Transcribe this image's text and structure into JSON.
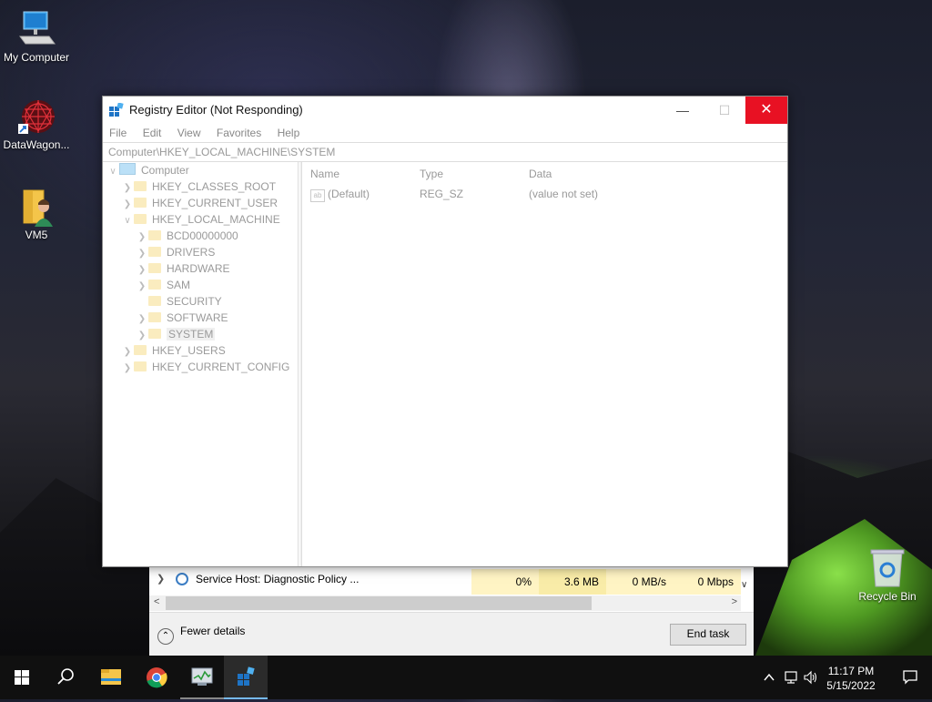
{
  "desktop": {
    "icons": [
      {
        "label": "My Computer"
      },
      {
        "label": "DataWagon..."
      },
      {
        "label": "VM5"
      },
      {
        "label": "Recycle Bin"
      }
    ]
  },
  "regedit": {
    "title": "Registry Editor (Not Responding)",
    "controls": {
      "minimize": "—",
      "maximize": "☐",
      "close": "✕"
    },
    "menu": [
      "File",
      "Edit",
      "View",
      "Favorites",
      "Help"
    ],
    "address": "Computer\\HKEY_LOCAL_MACHINE\\SYSTEM",
    "tree": {
      "root": "Computer",
      "items": [
        {
          "label": "HKEY_CLASSES_ROOT"
        },
        {
          "label": "HKEY_CURRENT_USER"
        },
        {
          "label": "HKEY_LOCAL_MACHINE"
        },
        {
          "label": "BCD00000000"
        },
        {
          "label": "DRIVERS"
        },
        {
          "label": "HARDWARE"
        },
        {
          "label": "SAM"
        },
        {
          "label": "SECURITY"
        },
        {
          "label": "SOFTWARE"
        },
        {
          "label": "SYSTEM"
        },
        {
          "label": "HKEY_USERS"
        },
        {
          "label": "HKEY_CURRENT_CONFIG"
        }
      ]
    },
    "columns": [
      "Name",
      "Type",
      "Data"
    ],
    "values": [
      {
        "name": "(Default)",
        "type": "REG_SZ",
        "data": "(value not set)",
        "icon": "ab"
      }
    ]
  },
  "taskmanager": {
    "row": {
      "name": "Service Host: Diagnostic Policy ...",
      "cpu": "0%",
      "memory": "3.6 MB",
      "disk": "0 MB/s",
      "network": "0 Mbps"
    },
    "fewer_details": "Fewer details",
    "end_task": "End task"
  },
  "taskbar": {
    "time": "11:17 PM",
    "date": "5/15/2022"
  },
  "colors": {
    "close_button": "#e81123",
    "taskbar": "#101010",
    "cell_highlight": "#fff4c4"
  }
}
